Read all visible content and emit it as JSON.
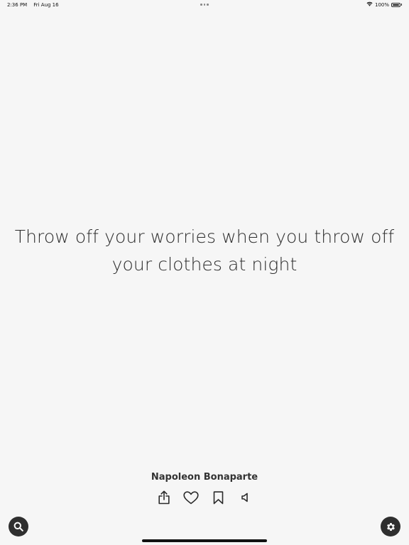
{
  "status_bar": {
    "time": "2:36 PM",
    "date": "Fri Aug 16",
    "battery_percent": "100%",
    "icons": [
      "wifi-icon",
      "battery-icon"
    ]
  },
  "quote": {
    "text": "Throw off your worries when you throw off your clothes at night",
    "author": "Napoleon Bonaparte"
  },
  "actions": [
    {
      "name": "share",
      "icon": "share-icon"
    },
    {
      "name": "like",
      "icon": "heart-icon"
    },
    {
      "name": "bookmark",
      "icon": "bookmark-icon"
    },
    {
      "name": "speak",
      "icon": "speaker-icon"
    }
  ],
  "buttons": {
    "search": {
      "icon": "search-icon"
    },
    "settings": {
      "icon": "gear-icon"
    }
  },
  "colors": {
    "background": "#f6f6f6",
    "text": "#2e2e2e",
    "fab": "#2f2f2f"
  }
}
